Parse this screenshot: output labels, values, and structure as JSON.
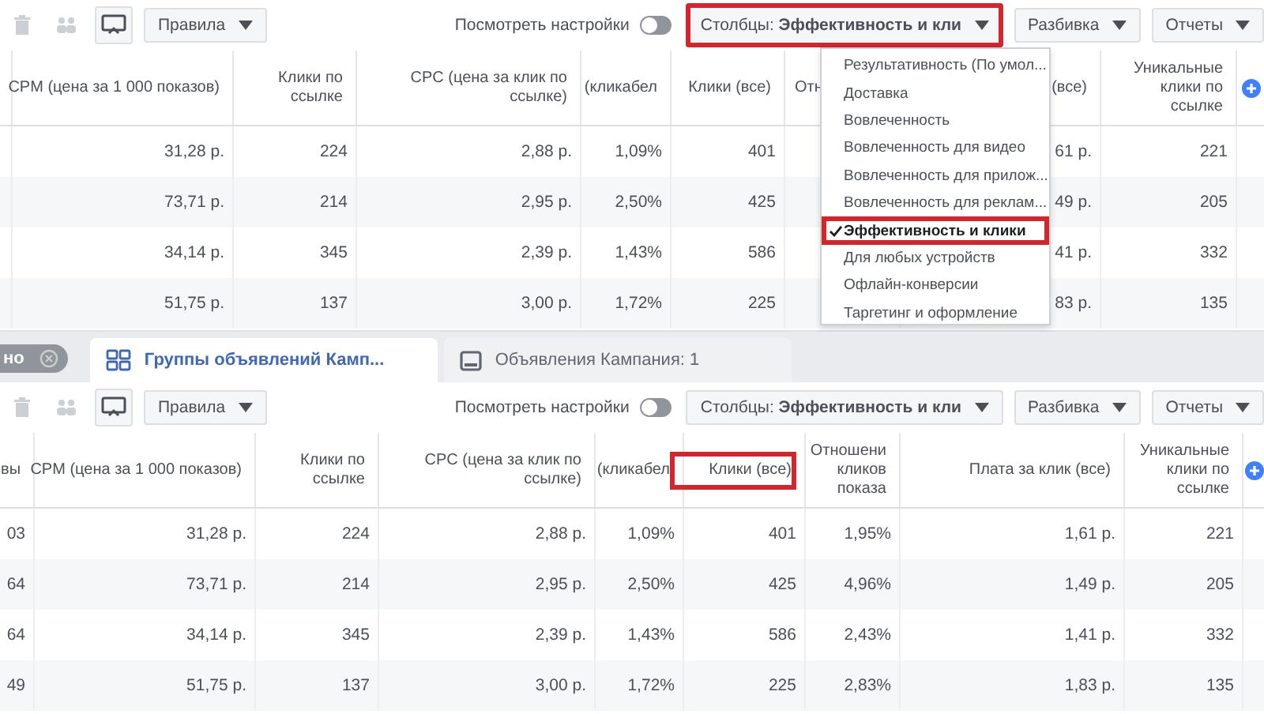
{
  "top_panel": {
    "toolbar": {
      "rules_button": "Правила",
      "settings_label": "Посмотреть настройки",
      "settings_toggle": {
        "on": false
      },
      "columns_button": {
        "label": "Столбцы: **Эффективность и кли**",
        "highlighted": true
      },
      "breakdown_button": "Разбивка",
      "reports_button": "Отчеты"
    },
    "table": {
      "columns": [
        {
          "lines": [
            "CPM (цена за 1 000 показов)"
          ],
          "highlighted": false
        },
        {
          "lines": [
            "Клики по",
            "ссылке"
          ],
          "highlighted": false
        },
        {
          "lines": [
            "CPC (цена за клик по",
            "ссылке)"
          ],
          "highlighted": false
        },
        {
          "lines": [
            "(кликабел"
          ],
          "highlighted": false
        },
        {
          "lines": [
            "Клики (все)"
          ],
          "highlighted": false
        },
        {
          "lines": [
            "Отн"
          ],
          "highlighted": false
        },
        {
          "lines": [
            "(все)"
          ],
          "highlighted": false
        },
        {
          "lines": [
            "Уникальные",
            "клики по",
            "ссылке"
          ],
          "highlighted": false
        }
      ],
      "rows": [
        [
          "31,28 р.",
          "224",
          "2,88 р.",
          "1,09%",
          "401",
          "",
          "61 р.",
          "221"
        ],
        [
          "73,71 р.",
          "214",
          "2,95 р.",
          "2,50%",
          "425",
          "",
          "49 р.",
          "205"
        ],
        [
          "34,14 р.",
          "345",
          "2,39 р.",
          "1,43%",
          "586",
          "",
          "41 р.",
          "332"
        ],
        [
          "51,75 р.",
          "137",
          "3,00 р.",
          "1,72%",
          "225",
          "",
          "83 р.",
          "135"
        ]
      ]
    },
    "columns_menu": {
      "items": [
        {
          "label": "Результативность (По умол...",
          "selected": false,
          "highlighted": false
        },
        {
          "label": "Доставка",
          "selected": false,
          "highlighted": false
        },
        {
          "label": "Вовлеченность",
          "selected": false,
          "highlighted": false
        },
        {
          "label": "Вовлеченность для видео",
          "selected": false,
          "highlighted": false
        },
        {
          "label": "Вовлеченность для прилож...",
          "selected": false,
          "highlighted": false
        },
        {
          "label": "Вовлеченность для реклам...",
          "selected": false,
          "highlighted": false
        },
        {
          "label": "Эффективность и клики",
          "selected": true,
          "highlighted": true
        },
        {
          "label": "Для любых устройств",
          "selected": false,
          "highlighted": false
        },
        {
          "label": "Офлайн-конверсии",
          "selected": false,
          "highlighted": false
        },
        {
          "label": "Таргетинг и оформление",
          "selected": false,
          "highlighted": false
        }
      ]
    }
  },
  "bottom_panel": {
    "filter_pill": {
      "label": "но"
    },
    "tabs": [
      {
        "label": "Группы объявлений Камп...",
        "selected": true
      },
      {
        "label": "Объявления Кампания: 1",
        "selected": false
      }
    ],
    "toolbar": {
      "rules_button": "Правила",
      "settings_label": "Посмотреть настройки",
      "settings_toggle": {
        "on": false
      },
      "columns_button": {
        "label": "Столбцы: **Эффективность и кли**",
        "highlighted": false
      },
      "breakdown_button": "Разбивка",
      "reports_button": "Отчеты"
    },
    "table": {
      "columns": [
        {
          "lines": [
            "вы"
          ],
          "highlighted": false
        },
        {
          "lines": [
            "CPM (цена за 1 000 показов)"
          ],
          "highlighted": false
        },
        {
          "lines": [
            "Клики по",
            "ссылке"
          ],
          "highlighted": false
        },
        {
          "lines": [
            "CPC (цена за клик по",
            "ссылке)"
          ],
          "highlighted": false
        },
        {
          "lines": [
            "(кликабел"
          ],
          "highlighted": false
        },
        {
          "lines": [
            "Клики (все)"
          ],
          "highlighted": true
        },
        {
          "lines": [
            "Отношени",
            "кликов",
            "показа"
          ],
          "highlighted": false
        },
        {
          "lines": [
            "Плата за клик (все)"
          ],
          "highlighted": false
        },
        {
          "lines": [
            "Уникальные",
            "клики по",
            "ссылке"
          ],
          "highlighted": false
        }
      ],
      "rows": [
        [
          "03",
          "31,28 р.",
          "224",
          "2,88 р.",
          "1,09%",
          "401",
          "1,95%",
          "1,61 р.",
          "221"
        ],
        [
          "64",
          "73,71 р.",
          "214",
          "2,95 р.",
          "2,50%",
          "425",
          "4,96%",
          "1,49 р.",
          "205"
        ],
        [
          "64",
          "34,14 р.",
          "345",
          "2,39 р.",
          "1,43%",
          "586",
          "2,43%",
          "1,41 р.",
          "332"
        ],
        [
          "49",
          "51,75 р.",
          "137",
          "3,00 р.",
          "1,72%",
          "225",
          "2,83%",
          "1,83 р.",
          "135"
        ]
      ]
    }
  }
}
